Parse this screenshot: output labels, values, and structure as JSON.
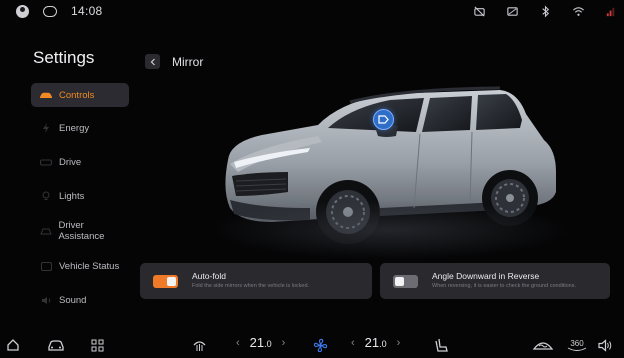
{
  "status_bar": {
    "time": "14:08",
    "left_icons": [
      "avatar-icon",
      "message-icon"
    ],
    "right_icons": [
      "camera-off-icon",
      "screen-icon",
      "bluetooth-icon",
      "wifi-icon",
      "signal-icon"
    ]
  },
  "sidebar": {
    "title": "Settings",
    "items": [
      {
        "label": "Controls",
        "icon": "car-controls-icon",
        "active": true
      },
      {
        "label": "Energy",
        "icon": "energy-icon",
        "active": false
      },
      {
        "label": "Drive",
        "icon": "drive-icon",
        "active": false
      },
      {
        "label": "Lights",
        "icon": "light-icon",
        "active": false
      },
      {
        "label": "Driver Assistance",
        "icon": "driver-assistance-icon",
        "active": false
      },
      {
        "label": "Vehicle Status",
        "icon": "vehicle-status-icon",
        "active": false
      },
      {
        "label": "Sound",
        "icon": "sound-icon",
        "active": false
      }
    ]
  },
  "header": {
    "title": "Mirror"
  },
  "options": {
    "auto_fold": {
      "title": "Auto-fold",
      "description": "Fold the side mirrors when the vehicle is locked.",
      "enabled": true
    },
    "angle_reverse": {
      "title": "Angle Downward in Reverse",
      "description": "When reversing, it is easier to check the ground conditions.",
      "enabled": false
    }
  },
  "dock": {
    "left_temp": {
      "whole": "21",
      "decimal": ".0"
    },
    "right_temp": {
      "whole": "21",
      "decimal": ".0"
    },
    "decrease_glyph": "‹",
    "increase_glyph": "›",
    "camera_label": "360"
  },
  "colors": {
    "accent": "#F08A24",
    "mirror_marker": "#2F6EC8",
    "fan": "#3D7BF2",
    "background": "#050506",
    "card": "#303036"
  }
}
